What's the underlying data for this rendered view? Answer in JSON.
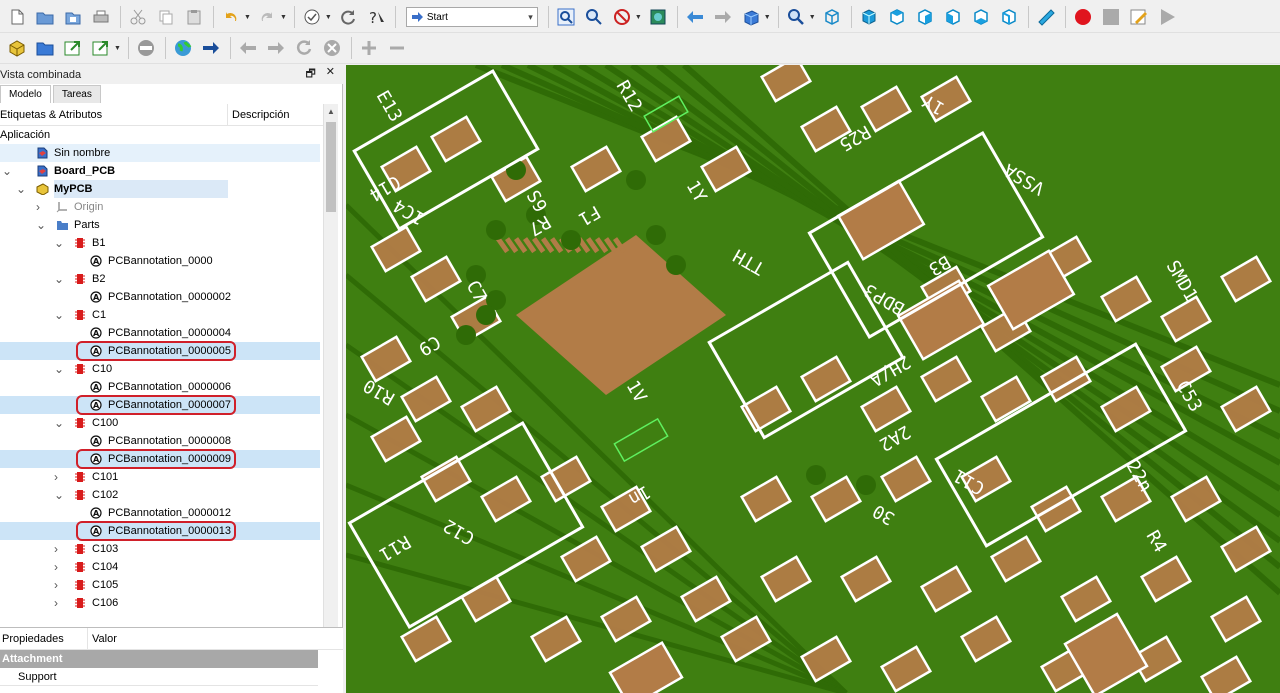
{
  "toolbar": {
    "workbench_combo": "Start"
  },
  "panel": {
    "title": "Vista combinada",
    "tabs": [
      "Modelo",
      "Tareas"
    ],
    "tree_columns": [
      "Etiquetas & Atributos",
      "Descripción"
    ],
    "tree": [
      {
        "label": "Aplicación",
        "level": 0,
        "twisty": "",
        "icon": "none"
      },
      {
        "label": "Sin nombre",
        "level": 1,
        "twisty": "",
        "icon": "document",
        "selected": true
      },
      {
        "label": "Board_PCB",
        "level": 1,
        "twisty": "v",
        "icon": "document",
        "bold": true
      },
      {
        "label": "MyPCB",
        "level": 2,
        "twisty": "v",
        "icon": "part",
        "bold": true,
        "highlight": true
      },
      {
        "label": "Origin",
        "level": 3,
        "twisty": ">",
        "icon": "origin",
        "grey": true
      },
      {
        "label": "Parts",
        "level": 3,
        "twisty": "v",
        "icon": "folder"
      },
      {
        "label": "B1",
        "level": 4,
        "twisty": "v",
        "icon": "chip"
      },
      {
        "label": "PCBannotation_0000",
        "level": 5,
        "twisty": "",
        "icon": "annotation"
      },
      {
        "label": "B2",
        "level": 4,
        "twisty": "v",
        "icon": "chip"
      },
      {
        "label": "PCBannotation_0000002",
        "level": 5,
        "twisty": "",
        "icon": "annotation"
      },
      {
        "label": "C1",
        "level": 4,
        "twisty": "v",
        "icon": "chip"
      },
      {
        "label": "PCBannotation_0000004",
        "level": 5,
        "twisty": "",
        "icon": "annotation"
      },
      {
        "label": "PCBannotation_0000005",
        "level": 5,
        "twisty": "",
        "icon": "annotation",
        "selected": true,
        "marked": true
      },
      {
        "label": "C10",
        "level": 4,
        "twisty": "v",
        "icon": "chip"
      },
      {
        "label": "PCBannotation_0000006",
        "level": 5,
        "twisty": "",
        "icon": "annotation"
      },
      {
        "label": "PCBannotation_0000007",
        "level": 5,
        "twisty": "",
        "icon": "annotation",
        "selected": true,
        "marked": true
      },
      {
        "label": "C100",
        "level": 4,
        "twisty": "v",
        "icon": "chip"
      },
      {
        "label": "PCBannotation_0000008",
        "level": 5,
        "twisty": "",
        "icon": "annotation"
      },
      {
        "label": "PCBannotation_0000009",
        "level": 5,
        "twisty": "",
        "icon": "annotation",
        "selected": true,
        "marked": true
      },
      {
        "label": "C101",
        "level": 4,
        "twisty": ">",
        "icon": "chip"
      },
      {
        "label": "C102",
        "level": 4,
        "twisty": "v",
        "icon": "chip"
      },
      {
        "label": "PCBannotation_0000012",
        "level": 5,
        "twisty": "",
        "icon": "annotation"
      },
      {
        "label": "PCBannotation_0000013",
        "level": 5,
        "twisty": "",
        "icon": "annotation",
        "selected": true,
        "marked": true
      },
      {
        "label": "C103",
        "level": 4,
        "twisty": ">",
        "icon": "chip"
      },
      {
        "label": "C104",
        "level": 4,
        "twisty": ">",
        "icon": "chip"
      },
      {
        "label": "C105",
        "level": 4,
        "twisty": ">",
        "icon": "chip"
      },
      {
        "label": "C106",
        "level": 4,
        "twisty": ">",
        "icon": "chip"
      }
    ],
    "properties": {
      "columns": [
        "Propiedades",
        "Valor"
      ],
      "group": "Attachment",
      "rows": [
        "Support"
      ]
    }
  },
  "view3d": {
    "board_text": [
      "E13",
      "C14",
      "1C4",
      "R12",
      "C9",
      "R10",
      "C7",
      "R11",
      "C12",
      "S9",
      "R25",
      "1Y",
      "1V",
      "B3",
      "VSSA",
      "SMD1",
      "2H/A",
      "BDP3",
      "22n",
      "2A2",
      "TTH",
      "1Y",
      "R7",
      "C11",
      "R4",
      "F1",
      "30",
      "C53",
      "1n"
    ],
    "colors": {
      "board": "#3f7f11",
      "trace": "#2f6b06",
      "pad": "#b27c47",
      "silk": "#ffffff",
      "hi": "#5ff05f"
    }
  }
}
